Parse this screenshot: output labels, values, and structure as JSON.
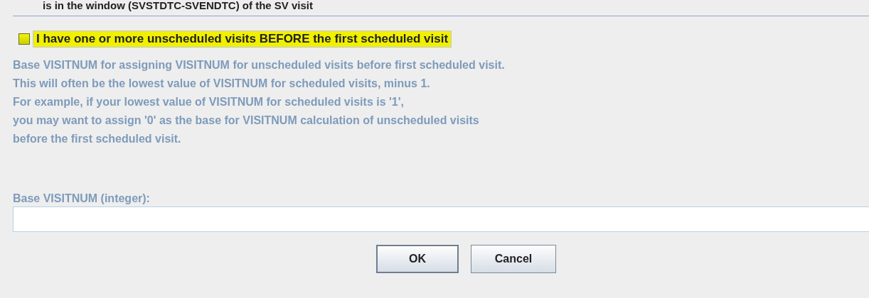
{
  "cut_line": "is in the window (SVSTDTC-SVENDTC) of the SV visit",
  "option": {
    "label": "I have one or more unscheduled visits BEFORE the first scheduled visit",
    "checked": false,
    "highlighted": true
  },
  "details": {
    "disabled": true,
    "description": [
      "Base VISITNUM for assigning VISITNUM for unscheduled visits before first scheduled visit.",
      "This will often be the lowest value of VISITNUM for scheduled visits, minus 1.",
      "For example, if your lowest value of VISITNUM for scheduled visits is '1',",
      "you may want to assign '0' as the base for VISITNUM calculation of unscheduled visits",
      "before the first scheduled visit."
    ],
    "field_label": "Base VISITNUM (integer):"
  },
  "buttons": [
    {
      "label": "OK",
      "default": true
    },
    {
      "label": "Cancel",
      "default": false
    }
  ]
}
